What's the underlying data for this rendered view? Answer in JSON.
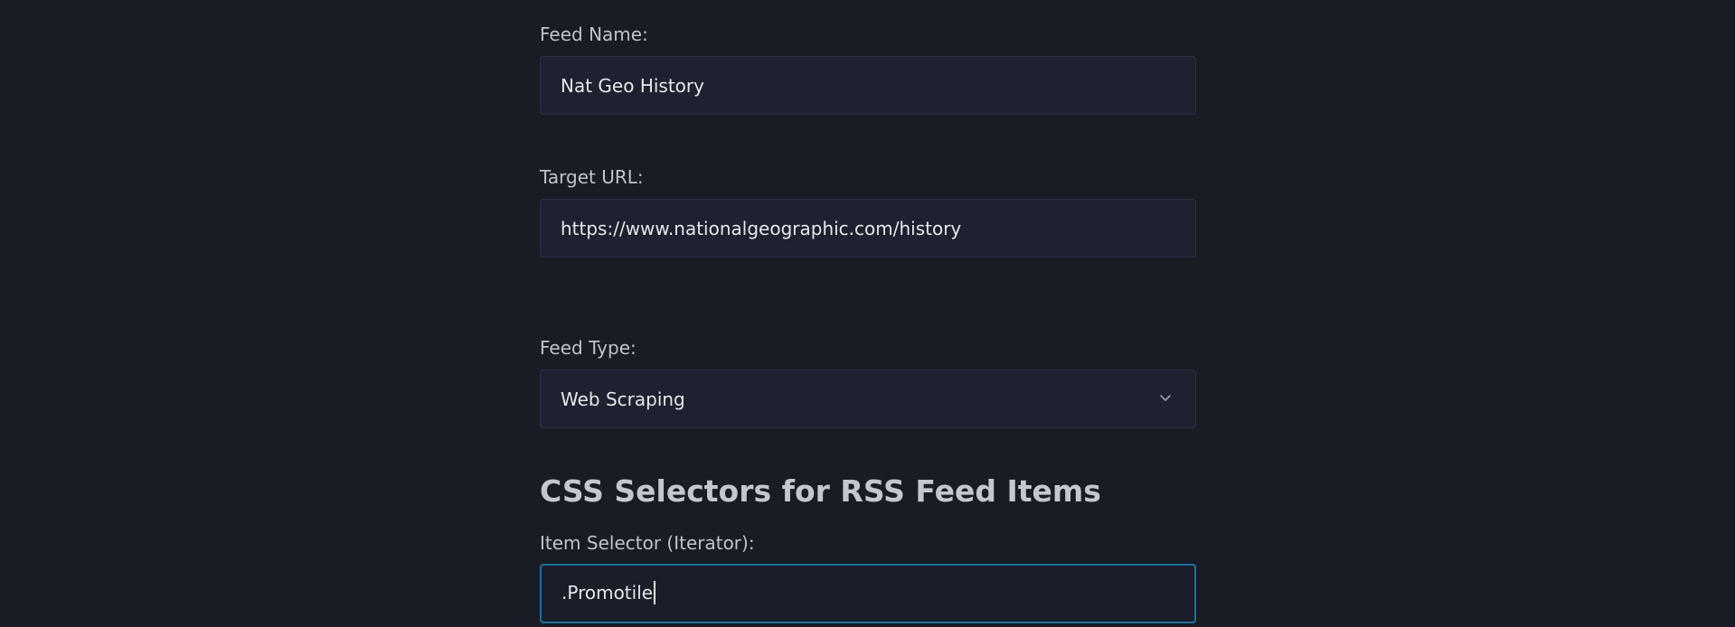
{
  "form": {
    "feed_name": {
      "label": "Feed Name:",
      "value": "Nat Geo History"
    },
    "target_url": {
      "label": "Target URL:",
      "value": "https://www.nationalgeographic.com/history"
    },
    "feed_type": {
      "label": "Feed Type:",
      "selected": "Web Scraping",
      "icon": "chevron-down-icon"
    },
    "selectors_section": {
      "heading": "CSS Selectors for RSS Feed Items"
    },
    "item_selector": {
      "label": "Item Selector (Iterator):",
      "value": ".Promotile"
    }
  },
  "colors": {
    "background": "#191c24",
    "field_background": "#1e2130",
    "field_border": "#2c3040",
    "focus_border": "#1f6f9e",
    "text": "#e5e7eb",
    "label": "#bfc3ca"
  }
}
